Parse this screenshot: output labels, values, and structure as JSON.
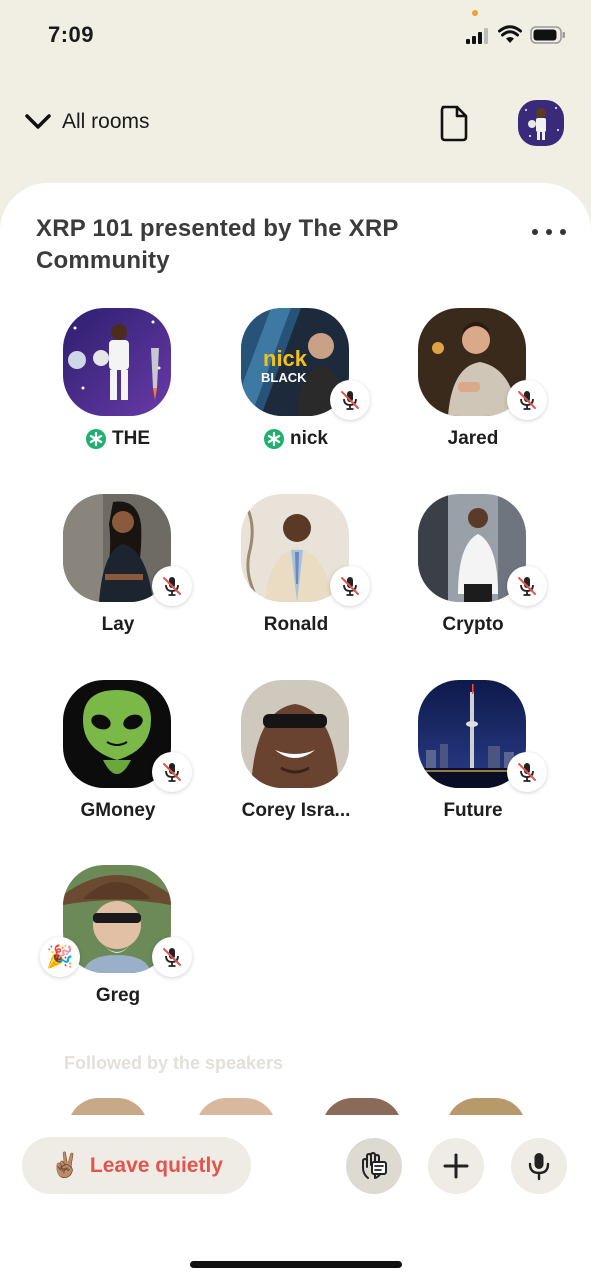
{
  "status_bar": {
    "time": "7:09"
  },
  "nav": {
    "back_label": "All rooms",
    "back_icon": "chevron-down-icon",
    "doc_icon": "document-icon"
  },
  "room": {
    "title": "XRP 101 presented by The XRP Community",
    "speakers": [
      {
        "name": "THE",
        "moderator": true,
        "muted": false
      },
      {
        "name": "nick",
        "moderator": true,
        "muted": true,
        "avatar_text": [
          "nick",
          "BLACK"
        ]
      },
      {
        "name": "Jared",
        "moderator": false,
        "muted": true
      },
      {
        "name": "Lay",
        "moderator": false,
        "muted": true
      },
      {
        "name": "Ronald",
        "moderator": false,
        "muted": true
      },
      {
        "name": "Crypto",
        "moderator": false,
        "muted": true
      },
      {
        "name": "GMoney",
        "moderator": false,
        "muted": true
      },
      {
        "name": "Corey Isra...",
        "moderator": false,
        "muted": true
      },
      {
        "name": "Future",
        "moderator": false,
        "muted": true
      },
      {
        "name": "Greg",
        "moderator": false,
        "muted": true,
        "badge": "🎉"
      }
    ],
    "followed_label": "Followed by the speakers"
  },
  "bottom_bar": {
    "leave_label": "Leave quietly",
    "leave_emoji": "✌🏽",
    "actions": [
      "raise-hand-icon",
      "plus-icon",
      "microphone-icon"
    ]
  },
  "colors": {
    "background": "#F1EFE4",
    "leave_text": "#E2554E",
    "moderator_green": "#1FAF6E"
  }
}
